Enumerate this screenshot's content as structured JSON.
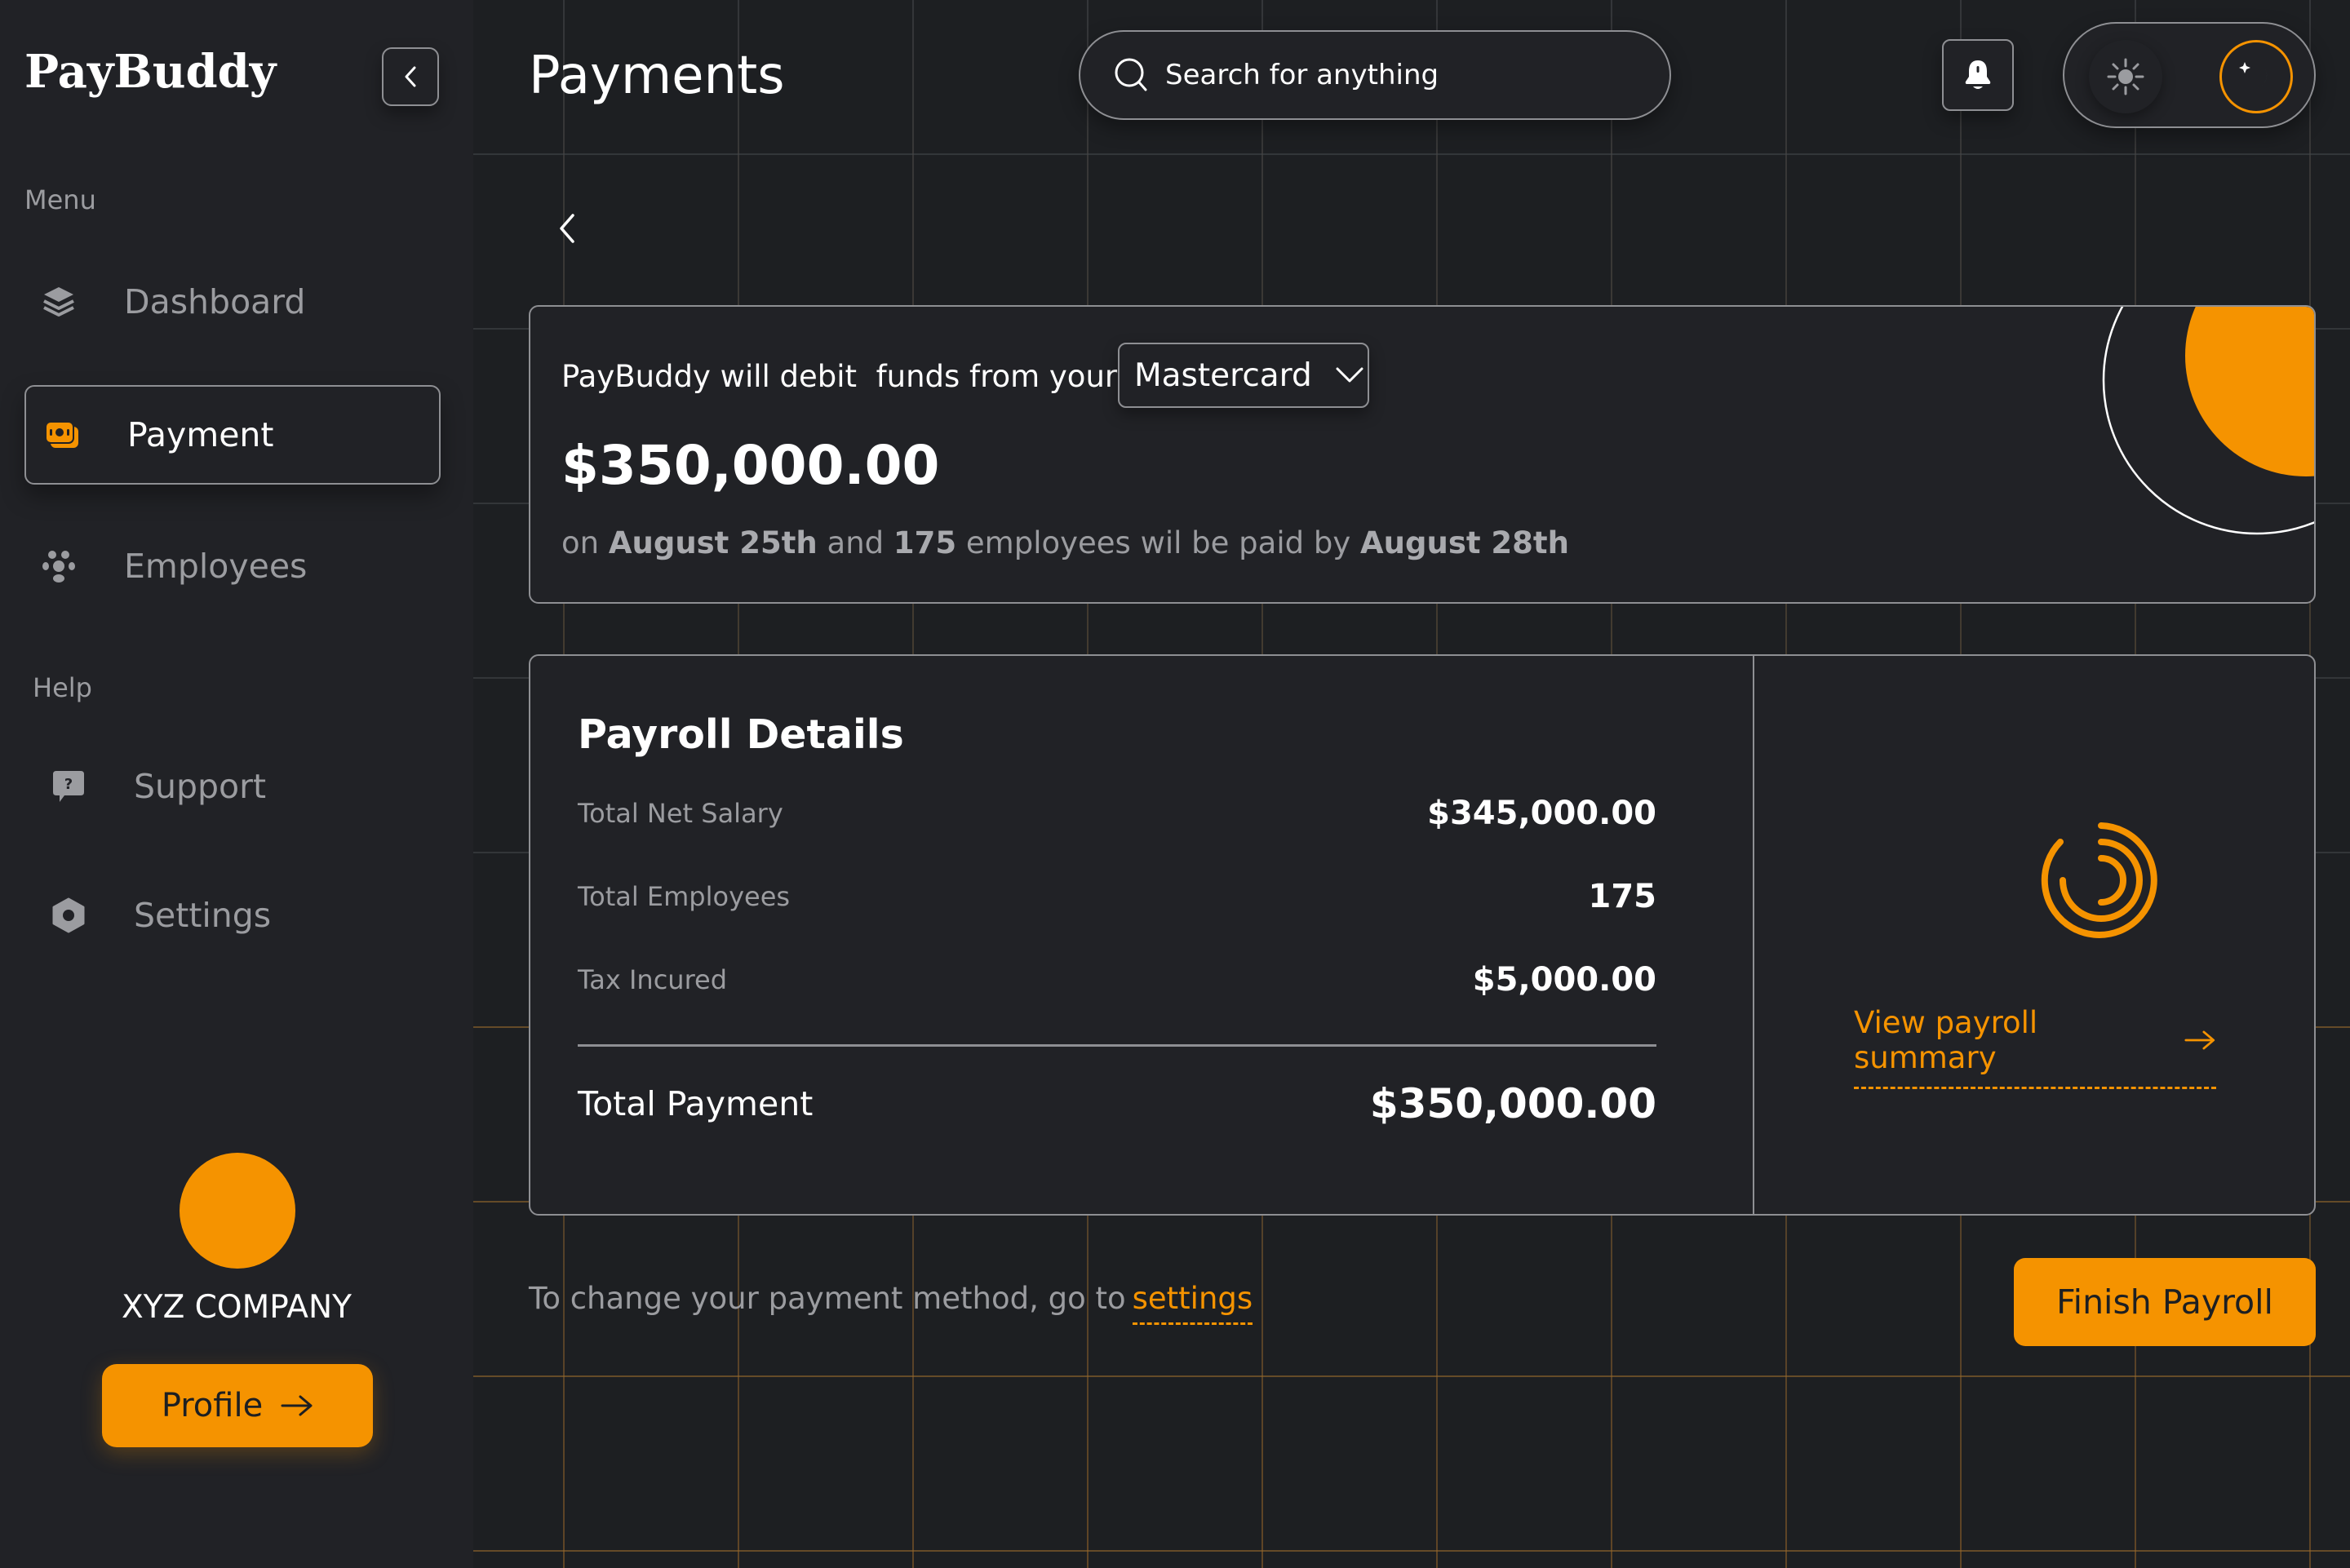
{
  "app": {
    "name": "PayBuddy"
  },
  "colors": {
    "accent": "#f59300",
    "background": "#1d1f22",
    "panel": "#212226",
    "border": "#8e8f93",
    "muted_text": "#9b9ca0"
  },
  "sidebar": {
    "collapse_icon": "chevron-left-icon",
    "menu_label": "Menu",
    "menu_items": [
      {
        "label": "Dashboard",
        "icon": "layers-icon",
        "active": false
      },
      {
        "label": "Payment",
        "icon": "money-icon",
        "active": true
      },
      {
        "label": "Employees",
        "icon": "users-icon",
        "active": false
      }
    ],
    "help_label": "Help",
    "help_items": [
      {
        "label": "Support",
        "icon": "help-chat-icon"
      },
      {
        "label": "Settings",
        "icon": "settings-icon"
      }
    ],
    "company_name": "XYZ COMPANY",
    "profile_button": "Profile"
  },
  "header": {
    "title": "Payments",
    "search_placeholder": "Search for anything",
    "notification_icon": "bell-icon",
    "theme_toggle": {
      "options": [
        "light",
        "dark"
      ],
      "selected": "dark"
    }
  },
  "debit_card": {
    "text": "PayBuddy will debit  funds from your",
    "payment_method": "Mastercard",
    "amount": "$350,000.00",
    "note": {
      "prefix": "on ",
      "debit_date": "August 25th",
      "mid1": " and ",
      "employee_count": "175",
      "mid2": " employees wil be paid by ",
      "pay_date": "August 28th"
    }
  },
  "payroll": {
    "title": "Payroll Details",
    "rows": [
      {
        "label": "Total Net Salary",
        "value": "$345,000.00"
      },
      {
        "label": "Total Employees",
        "value": "175"
      },
      {
        "label": "Tax Incured",
        "value": "$5,000.00"
      }
    ],
    "total_label": "Total Payment",
    "total_value": "$350,000.00",
    "summary_link": "View payroll summary"
  },
  "footer": {
    "note": "To change your payment method, go to",
    "link": "settings",
    "finish_button": "Finish Payroll"
  }
}
